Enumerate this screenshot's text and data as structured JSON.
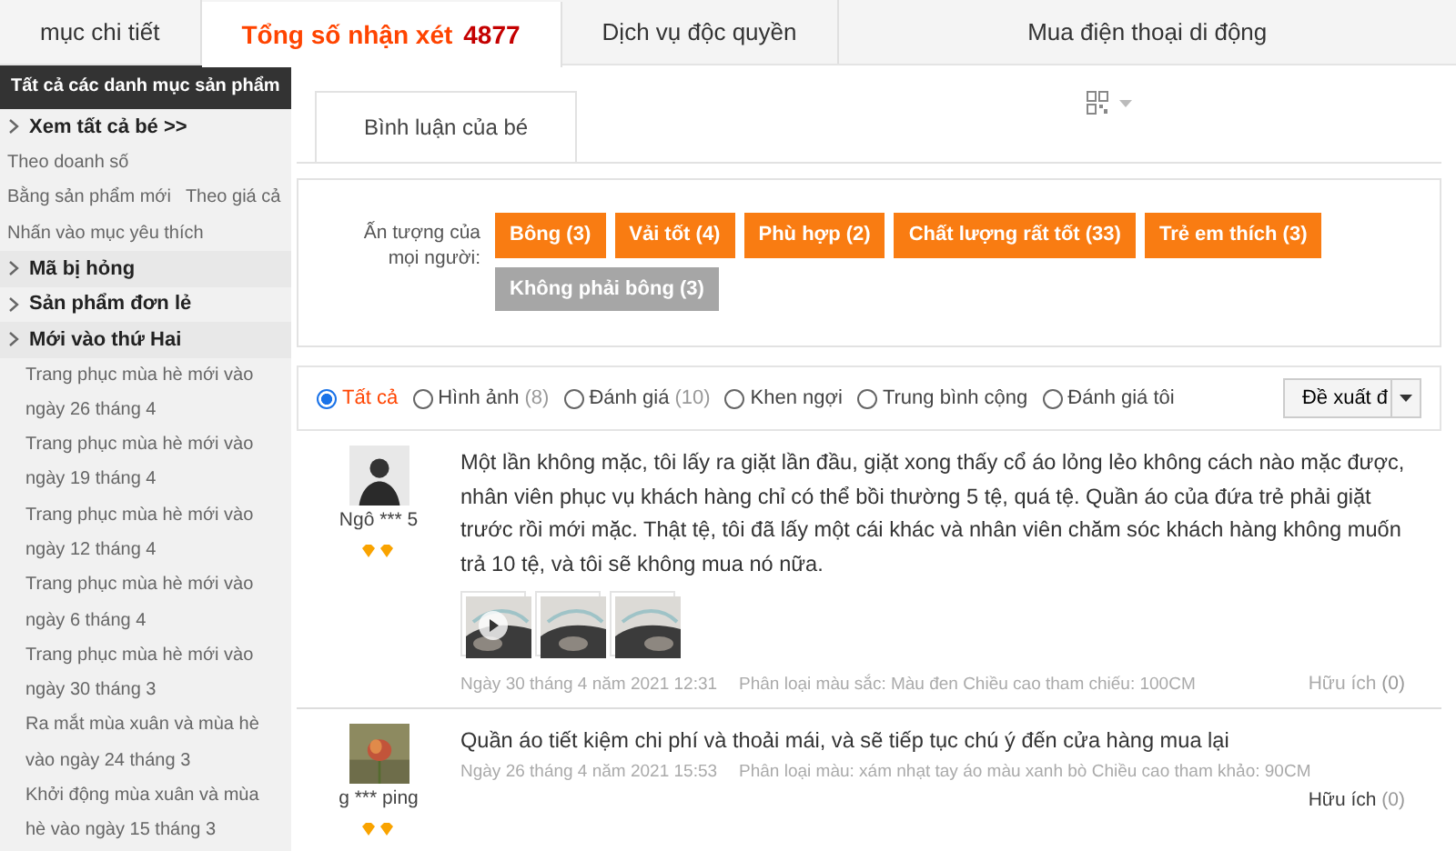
{
  "top_tabs": [
    {
      "label": "mục chi tiết",
      "selected": false
    },
    {
      "label": "Tổng số nhận xét",
      "count": "4877",
      "selected": true
    },
    {
      "label": "Dịch vụ độc quyền",
      "selected": false
    },
    {
      "label": "Mua điện thoại di động",
      "selected": false
    }
  ],
  "sidebar": {
    "title": "Tất cả các danh mục sản phẩm",
    "items": [
      {
        "kind": "category",
        "label": "Xem tất cả bé >>"
      },
      {
        "kind": "link",
        "labels": [
          "Theo doanh số"
        ]
      },
      {
        "kind": "link",
        "labels": [
          "Bằng sản phẩm mới",
          "Theo giá cả"
        ]
      },
      {
        "kind": "link",
        "labels": [
          "Nhấn vào mục yêu thích"
        ]
      },
      {
        "kind": "category",
        "label": "Mã bị hỏng"
      },
      {
        "kind": "category",
        "label": "Sản phẩm đơn lẻ"
      },
      {
        "kind": "category",
        "label": "Mới vào thứ Hai",
        "children": [
          {
            "label": "Trang phục mùa hè mới vào ngày 26 tháng 4"
          },
          {
            "label": "Trang phục mùa hè mới vào ngày 19 tháng 4"
          },
          {
            "label": "Trang phục mùa hè mới vào ngày 12 tháng 4"
          },
          {
            "label": "Trang phục mùa hè mới vào ngày 6 tháng 4"
          },
          {
            "label": "Trang phục mùa hè mới vào ngày 30 tháng 3"
          },
          {
            "label": "Ra mắt mùa xuân và mùa hè vào ngày 24 tháng 3"
          },
          {
            "label": "Khởi động mùa xuân và mùa hè vào ngày 15 tháng 3"
          }
        ]
      }
    ]
  },
  "sub_tab": {
    "label": "Bình luận của bé"
  },
  "impressions": {
    "label": "Ấn tượng của mọi người:",
    "tags": [
      {
        "label": "Bông (3)",
        "kind": "positive"
      },
      {
        "label": "Vải tốt (4)",
        "kind": "positive"
      },
      {
        "label": "Phù hợp (2)",
        "kind": "positive"
      },
      {
        "label": "Chất lượng rất tốt (33)",
        "kind": "positive"
      },
      {
        "label": "Trẻ em thích (3)",
        "kind": "positive"
      },
      {
        "label": "Không phải bông (3)",
        "kind": "negative"
      }
    ]
  },
  "filters": [
    {
      "label": "Tất cả",
      "selected": true
    },
    {
      "label": "Hình ảnh",
      "count": "(8)",
      "selected": false
    },
    {
      "label": "Đánh giá",
      "count": "(10)",
      "selected": false
    },
    {
      "label": "Khen ngợi",
      "selected": false
    },
    {
      "label": "Trung bình cộng",
      "selected": false
    },
    {
      "label": "Đánh giá tôi",
      "selected": false
    }
  ],
  "sort": {
    "value": "Đề xuất đ"
  },
  "reviews": [
    {
      "user": "Ngô *** 5",
      "text": "Một lần không mặc, tôi lấy ra giặt lần đầu, giặt xong thấy cổ áo lỏng lẻo không cách nào mặc được, nhân viên phục vụ khách hàng chỉ có thể bồi thường 5 tệ, quá tệ. Quần áo của đứa trẻ phải giặt trước rồi mới mặc. Thật tệ, tôi đã lấy một cái khác và nhân viên chăm sóc khách hàng không muốn trả 10 tệ, và tôi sẽ không mua nó nữa.",
      "photos": [
        {
          "kind": "video"
        },
        {
          "kind": "picture"
        },
        {
          "kind": "picture"
        }
      ],
      "date": "Ngày 30 tháng 4 năm 2021 12:31",
      "spec": "Phân loại màu sắc: Màu đen Chiều cao tham chiếu: 100CM",
      "helpful": "Hữu ích",
      "helpful_count": "(0)"
    },
    {
      "user": "g *** ping",
      "text": "Quần áo tiết kiệm chi phí và thoải mái, và sẽ tiếp tục chú ý đến cửa hàng mua lại",
      "date": "Ngày 26 tháng 4 năm 2021 15:53",
      "spec": "Phân loại màu: xám nhạt tay áo màu xanh bò Chiều cao tham khảo: 90CM",
      "helpful": "Hữu ích",
      "helpful_count": "(0)"
    }
  ]
}
